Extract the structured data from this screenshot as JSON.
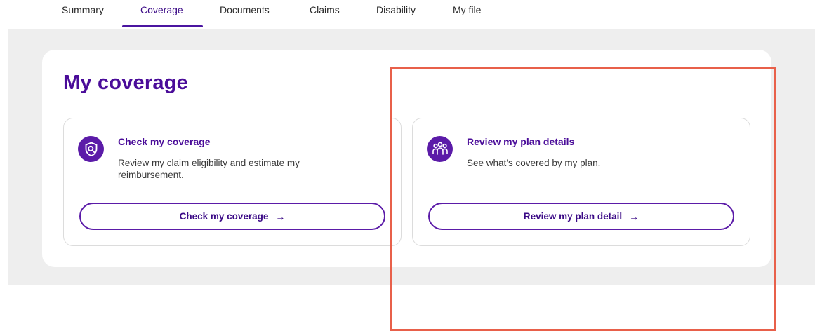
{
  "tabs": {
    "items": [
      {
        "label": "Summary",
        "active": false
      },
      {
        "label": "Coverage",
        "active": true
      },
      {
        "label": "Documents",
        "active": false
      },
      {
        "label": "Claims",
        "active": false
      },
      {
        "label": "Disability",
        "active": false
      },
      {
        "label": "My file",
        "active": false
      }
    ]
  },
  "page": {
    "title": "My coverage"
  },
  "cards": [
    {
      "icon": "shield-search-icon",
      "title": "Check my coverage",
      "description": "Review my claim eligibility and estimate my reimbursement.",
      "button_label": "Check my coverage",
      "button_arrow": "→"
    },
    {
      "icon": "people-group-icon",
      "title": "Review my plan details",
      "description": "See what’s covered by my plan.",
      "button_label": "Review my plan detail",
      "button_arrow": "→"
    }
  ],
  "colors": {
    "brand_purple": "#4a0c99",
    "icon_purple": "#5b1ba8",
    "highlight": "#e8604a",
    "band_gray": "#eeeeee"
  }
}
